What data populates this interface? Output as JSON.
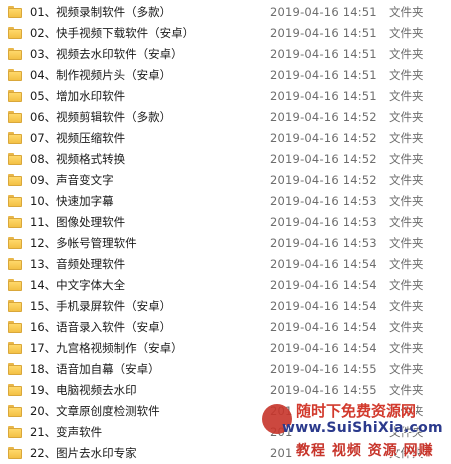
{
  "files": [
    {
      "name": "01、视频录制软件（多款）",
      "date": "2019-04-16 14:51",
      "type": "文件夹"
    },
    {
      "name": "02、快手视频下载软件（安卓）",
      "date": "2019-04-16 14:51",
      "type": "文件夹"
    },
    {
      "name": "03、视频去水印软件（安卓）",
      "date": "2019-04-16 14:51",
      "type": "文件夹"
    },
    {
      "name": "04、制作视频片头（安卓）",
      "date": "2019-04-16 14:51",
      "type": "文件夹"
    },
    {
      "name": "05、增加水印软件",
      "date": "2019-04-16 14:51",
      "type": "文件夹"
    },
    {
      "name": "06、视频剪辑软件（多款）",
      "date": "2019-04-16 14:52",
      "type": "文件夹"
    },
    {
      "name": "07、视频压缩软件",
      "date": "2019-04-16 14:52",
      "type": "文件夹"
    },
    {
      "name": "08、视频格式转换",
      "date": "2019-04-16 14:52",
      "type": "文件夹"
    },
    {
      "name": "09、声音变文字",
      "date": "2019-04-16 14:52",
      "type": "文件夹"
    },
    {
      "name": "10、快速加字幕",
      "date": "2019-04-16 14:53",
      "type": "文件夹"
    },
    {
      "name": "11、图像处理软件",
      "date": "2019-04-16 14:53",
      "type": "文件夹"
    },
    {
      "name": "12、多帐号管理软件",
      "date": "2019-04-16 14:53",
      "type": "文件夹"
    },
    {
      "name": "13、音频处理软件",
      "date": "2019-04-16 14:54",
      "type": "文件夹"
    },
    {
      "name": "14、中文字体大全",
      "date": "2019-04-16 14:54",
      "type": "文件夹"
    },
    {
      "name": "15、手机录屏软件（安卓）",
      "date": "2019-04-16 14:54",
      "type": "文件夹"
    },
    {
      "name": "16、语音录入软件（安卓）",
      "date": "2019-04-16 14:54",
      "type": "文件夹"
    },
    {
      "name": "17、九宫格视频制作（安卓）",
      "date": "2019-04-16 14:54",
      "type": "文件夹"
    },
    {
      "name": "18、语音加自幕（安卓）",
      "date": "2019-04-16 14:55",
      "type": "文件夹"
    },
    {
      "name": "19、电脑视频去水印",
      "date": "2019-04-16 14:55",
      "type": "文件夹"
    },
    {
      "name": "20、文章原创度检测软件",
      "date": "201",
      "type": "文件夹"
    },
    {
      "name": "21、变声软件",
      "date": "201",
      "type": "文件夹"
    },
    {
      "name": "22、图片去水印专家",
      "date": "201",
      "type": "文件夹"
    }
  ],
  "icons": {
    "folder": "folder-icon"
  },
  "watermark": {
    "line1": "随时下免费资源网",
    "line2": "www.SuiShiXia.com",
    "line3": "教程 视频 资源 网赚"
  },
  "colors": {
    "folder": "#f3c045",
    "watermark_red": "#d23a2d",
    "watermark_blue": "#2b3a8c"
  }
}
